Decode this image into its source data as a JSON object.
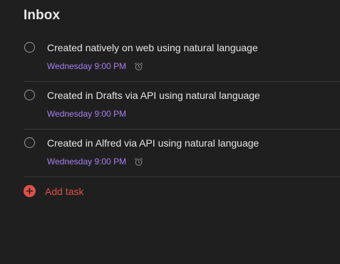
{
  "inbox": {
    "title": "Inbox",
    "tasks": [
      {
        "title": "Created natively on web using natural language",
        "due": "Wednesday 9:00 PM",
        "reminder": true
      },
      {
        "title": "Created in Drafts via API using natural language",
        "due": "Wednesday 9:00 PM",
        "reminder": false
      },
      {
        "title": "Created in Alfred via API using natural language",
        "due": "Wednesday 9:00 PM",
        "reminder": true
      }
    ],
    "add_task_label": "Add task"
  },
  "colors": {
    "background": "#1f1f1f",
    "due_date": "#a97ff2",
    "add_task": "#e0504a"
  },
  "icons": {
    "reminder": "alarm-clock-icon",
    "add": "plus-circle-icon"
  }
}
